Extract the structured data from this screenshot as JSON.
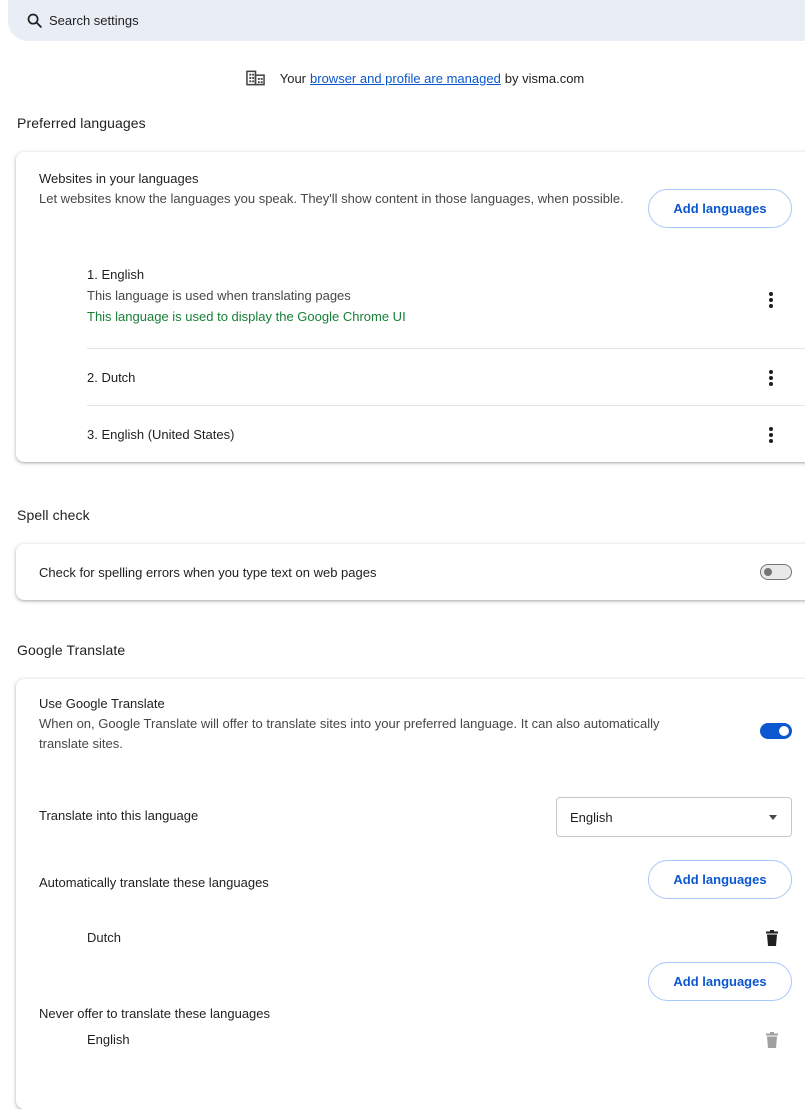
{
  "search": {
    "placeholder": "Search settings"
  },
  "managed": {
    "prefix": "Your",
    "link": "browser and profile are managed",
    "suffix": "by visma.com"
  },
  "preferred": {
    "title": "Preferred languages",
    "heading": "Websites in your languages",
    "description": "Let websites know the languages you speak. They'll show content in those languages, when possible.",
    "add_label": "Add languages",
    "languages": [
      {
        "name": "1. English",
        "line1": "This language is used when translating pages",
        "line2": "This language is used to display the Google Chrome UI"
      },
      {
        "name": "2. Dutch"
      },
      {
        "name": "3. English (United States)"
      }
    ]
  },
  "spell": {
    "title": "Spell check",
    "label": "Check for spelling errors when you type text on web pages",
    "enabled": false
  },
  "translate": {
    "title": "Google Translate",
    "heading": "Use Google Translate",
    "description": "When on, Google Translate will offer to translate sites into your preferred language. It can also automatically translate sites.",
    "enabled": true,
    "into_label": "Translate into this language",
    "into_value": "English",
    "auto_label": "Automatically translate these languages",
    "auto_add_label": "Add languages",
    "auto_languages": [
      "Dutch"
    ],
    "never_label": "Never offer to translate these languages",
    "never_add_label": "Add languages",
    "never_languages": [
      "English"
    ]
  },
  "colors": {
    "accent": "#0b57d0",
    "ui_language_note": "#188038",
    "search_bg": "#e9eef6"
  },
  "icons": [
    "search-icon",
    "building-icon",
    "more-vert-icon",
    "delete-icon"
  ]
}
